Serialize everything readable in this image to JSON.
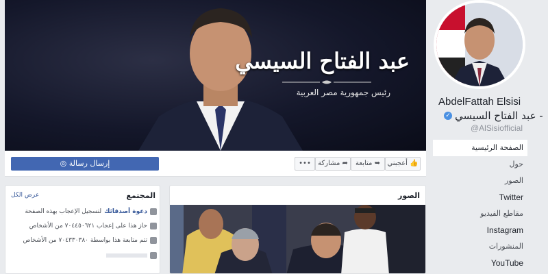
{
  "cover": {
    "name": "عبد الفتاح السيسي",
    "subtitle": "رئيس جمهورية مصر العربية"
  },
  "profile": {
    "name_en": "AbdelFattah Elsisi",
    "name_ar": "- عبد الفتاح السيسي",
    "handle": "@AlSisiofficial"
  },
  "nav": {
    "items": [
      {
        "label": "الصفحة الرئيسية",
        "active": true
      },
      {
        "label": "حول"
      },
      {
        "label": "الصور"
      },
      {
        "label": "Twitter"
      },
      {
        "label": "مقاطع الفيديو"
      },
      {
        "label": "Instagram"
      },
      {
        "label": "المنشورات"
      },
      {
        "label": "YouTube"
      }
    ]
  },
  "actions": {
    "message": "إرسال رسالة",
    "like": "أعجبني",
    "follow": "متابعة",
    "share": "مشاركة",
    "more": "•••"
  },
  "community": {
    "title": "المجتمع",
    "see_all": "عرض الكل",
    "invite_link": "دعوة أصدقائك",
    "invite_rest": "لتسجيل الإعجاب بهذه الصفحة",
    "likes": "حاز هذا على إعجاب ٧٠٤٤٥٠٦٢١ من الأشخاص",
    "follows": "تتم متابعة هذا بواسطة ٧٠٤٣٣٠٣٨٠ من الأشخاص"
  },
  "photos": {
    "title": "الصور"
  },
  "colors": {
    "brand_blue": "#4267b2",
    "link_blue": "#365899",
    "page_bg": "#e9ebee"
  }
}
